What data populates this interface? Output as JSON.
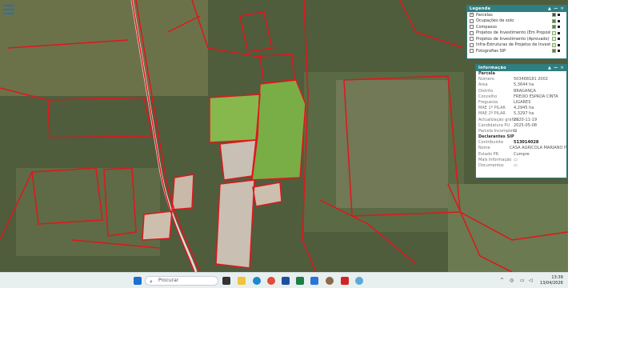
{
  "legend": {
    "title": "Legenda",
    "items": [
      {
        "label": "Parcelas",
        "checked": true,
        "swatch": "#4a4a4a"
      },
      {
        "label": "Ocupações de solo",
        "checked": false,
        "swatch": "#6a7a3a"
      },
      {
        "label": "Compasso",
        "checked": false,
        "swatch": "#6a7a3a"
      },
      {
        "label": "Projetos de Investimento (Em Proposta)",
        "checked": false,
        "swatch": "#f4f4b0"
      },
      {
        "label": "Projetos de Investimento (Aprovado)",
        "checked": false,
        "swatch": "#f4f4b0"
      },
      {
        "label": "Infra-Estruturas de Projetos de Investimento",
        "checked": false,
        "swatch": "#e8f0b0"
      },
      {
        "label": "Fotografias SIP",
        "checked": false,
        "swatch": "#6a7a3a"
      }
    ]
  },
  "info": {
    "title": "Informação",
    "section1": "Parcela",
    "rows1": [
      {
        "k": "Número",
        "v": "503468181 2002"
      },
      {
        "k": "Área",
        "v": "5,3644 ha"
      },
      {
        "k": "Distrito",
        "v": "BRAGANÇA"
      },
      {
        "k": "Concelho",
        "v": "FREIXO ESPADA CINTA"
      },
      {
        "k": "Freguesia",
        "v": "LIGARES"
      },
      {
        "k": "MAE 1º PILAR",
        "v": "4,2945 ha"
      },
      {
        "k": "MAE 2º PILAR",
        "v": "5,3297 ha"
      },
      {
        "k": "Actualização gráfica",
        "v": "2020-11-19"
      },
      {
        "k": "Candidatura PU",
        "v": "2025-05-08"
      },
      {
        "k": "Parcela Incompleta",
        "v": "☐"
      }
    ],
    "section2": "Declarantes SIP",
    "rows2": [
      {
        "k": "Contribuinte",
        "v": "513014028"
      },
      {
        "k": "Nome",
        "v": "CASA AGRICOLA MARIANO P"
      },
      {
        "k": "Estado PR",
        "v": "Cumpre"
      },
      {
        "k": "Mais Informação",
        "v": "▭"
      },
      {
        "k": "Documentos",
        "v": "▭"
      }
    ]
  },
  "taskbar": {
    "search_placeholder": "Procurar",
    "time": "13:39",
    "date": "13/04/2026"
  },
  "colors": {
    "panel_header": "#2f7f82",
    "parcel_outline": "#e0161c",
    "selected_parcel": "#7fb84a"
  }
}
